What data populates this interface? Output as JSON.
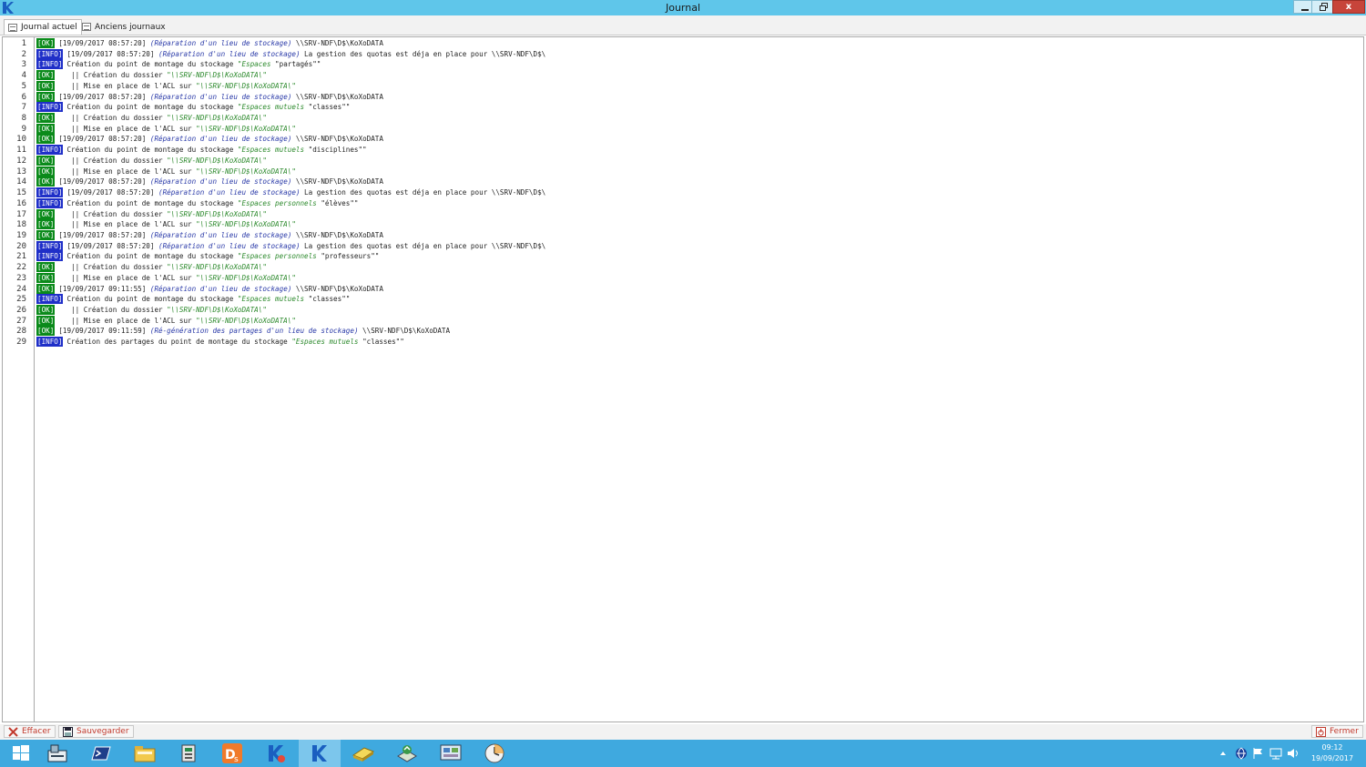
{
  "window": {
    "title": "Journal",
    "close_label": "x"
  },
  "tabs": [
    {
      "label": "Journal actuel",
      "icon": "log-icon",
      "active": true
    },
    {
      "label": "Anciens journaux",
      "icon": "log-icon",
      "active": false
    }
  ],
  "log_lines": [
    {
      "num": "1",
      "level": "[OK]",
      "ts": "[19/09/2017 08:57:20]",
      "ctx": "(Réparation d'un lieu de stockage)",
      "text": " \\\\SRV-NDF\\D$\\KoXoDATA",
      "quote": "",
      "tail": ""
    },
    {
      "num": "2",
      "level": "[INFO]",
      "ts": "[19/09/2017 08:57:20]",
      "ctx": "(Réparation d'un lieu de stockage)",
      "text": " La gestion des quotas est déja en place pour \\\\SRV-NDF\\D$\\",
      "quote": "",
      "tail": ""
    },
    {
      "num": "3",
      "level": "[INFO]",
      "ts": "",
      "ctx": "",
      "text": "Création du point de montage du stockage ",
      "quote": "\"Espaces ",
      "tail": "\"partagés\"\""
    },
    {
      "num": "4",
      "level": "[OK]",
      "ts": "",
      "ctx": "",
      "text": "   || Création du dossier ",
      "quote": "\"\\\\SRV-NDF\\D$\\KoXoDATA\\\"",
      "tail": ""
    },
    {
      "num": "5",
      "level": "[OK]",
      "ts": "",
      "ctx": "",
      "text": "   || Mise en place de l'ACL sur ",
      "quote": "\"\\\\SRV-NDF\\D$\\KoXoDATA\\\"",
      "tail": ""
    },
    {
      "num": "6",
      "level": "[OK]",
      "ts": "[19/09/2017 08:57:20]",
      "ctx": "(Réparation d'un lieu de stockage)",
      "text": " \\\\SRV-NDF\\D$\\KoXoDATA",
      "quote": "",
      "tail": ""
    },
    {
      "num": "7",
      "level": "[INFO]",
      "ts": "",
      "ctx": "",
      "text": "Création du point de montage du stockage ",
      "quote": "\"Espaces mutuels ",
      "tail": "\"classes\"\""
    },
    {
      "num": "8",
      "level": "[OK]",
      "ts": "",
      "ctx": "",
      "text": "   || Création du dossier ",
      "quote": "\"\\\\SRV-NDF\\D$\\KoXoDATA\\\"",
      "tail": ""
    },
    {
      "num": "9",
      "level": "[OK]",
      "ts": "",
      "ctx": "",
      "text": "   || Mise en place de l'ACL sur ",
      "quote": "\"\\\\SRV-NDF\\D$\\KoXoDATA\\\"",
      "tail": ""
    },
    {
      "num": "10",
      "level": "[OK]",
      "ts": "[19/09/2017 08:57:20]",
      "ctx": "(Réparation d'un lieu de stockage)",
      "text": " \\\\SRV-NDF\\D$\\KoXoDATA",
      "quote": "",
      "tail": ""
    },
    {
      "num": "11",
      "level": "[INFO]",
      "ts": "",
      "ctx": "",
      "text": "Création du point de montage du stockage ",
      "quote": "\"Espaces mutuels ",
      "tail": "\"disciplines\"\""
    },
    {
      "num": "12",
      "level": "[OK]",
      "ts": "",
      "ctx": "",
      "text": "   || Création du dossier ",
      "quote": "\"\\\\SRV-NDF\\D$\\KoXoDATA\\\"",
      "tail": ""
    },
    {
      "num": "13",
      "level": "[OK]",
      "ts": "",
      "ctx": "",
      "text": "   || Mise en place de l'ACL sur ",
      "quote": "\"\\\\SRV-NDF\\D$\\KoXoDATA\\\"",
      "tail": ""
    },
    {
      "num": "14",
      "level": "[OK]",
      "ts": "[19/09/2017 08:57:20]",
      "ctx": "(Réparation d'un lieu de stockage)",
      "text": " \\\\SRV-NDF\\D$\\KoXoDATA",
      "quote": "",
      "tail": ""
    },
    {
      "num": "15",
      "level": "[INFO]",
      "ts": "[19/09/2017 08:57:20]",
      "ctx": "(Réparation d'un lieu de stockage)",
      "text": " La gestion des quotas est déja en place pour \\\\SRV-NDF\\D$\\",
      "quote": "",
      "tail": ""
    },
    {
      "num": "16",
      "level": "[INFO]",
      "ts": "",
      "ctx": "",
      "text": "Création du point de montage du stockage ",
      "quote": "\"Espaces personnels ",
      "tail": "\"élèves\"\""
    },
    {
      "num": "17",
      "level": "[OK]",
      "ts": "",
      "ctx": "",
      "text": "   || Création du dossier ",
      "quote": "\"\\\\SRV-NDF\\D$\\KoXoDATA\\\"",
      "tail": ""
    },
    {
      "num": "18",
      "level": "[OK]",
      "ts": "",
      "ctx": "",
      "text": "   || Mise en place de l'ACL sur ",
      "quote": "\"\\\\SRV-NDF\\D$\\KoXoDATA\\\"",
      "tail": ""
    },
    {
      "num": "19",
      "level": "[OK]",
      "ts": "[19/09/2017 08:57:20]",
      "ctx": "(Réparation d'un lieu de stockage)",
      "text": " \\\\SRV-NDF\\D$\\KoXoDATA",
      "quote": "",
      "tail": ""
    },
    {
      "num": "20",
      "level": "[INFO]",
      "ts": "[19/09/2017 08:57:20]",
      "ctx": "(Réparation d'un lieu de stockage)",
      "text": " La gestion des quotas est déja en place pour \\\\SRV-NDF\\D$\\",
      "quote": "",
      "tail": ""
    },
    {
      "num": "21",
      "level": "[INFO]",
      "ts": "",
      "ctx": "",
      "text": "Création du point de montage du stockage ",
      "quote": "\"Espaces personnels ",
      "tail": "\"professeurs\"\""
    },
    {
      "num": "22",
      "level": "[OK]",
      "ts": "",
      "ctx": "",
      "text": "   || Création du dossier ",
      "quote": "\"\\\\SRV-NDF\\D$\\KoXoDATA\\\"",
      "tail": ""
    },
    {
      "num": "23",
      "level": "[OK]",
      "ts": "",
      "ctx": "",
      "text": "   || Mise en place de l'ACL sur ",
      "quote": "\"\\\\SRV-NDF\\D$\\KoXoDATA\\\"",
      "tail": ""
    },
    {
      "num": "24",
      "level": "[OK]",
      "ts": "[19/09/2017 09:11:55]",
      "ctx": "(Réparation d'un lieu de stockage)",
      "text": " \\\\SRV-NDF\\D$\\KoXoDATA",
      "quote": "",
      "tail": ""
    },
    {
      "num": "25",
      "level": "[INFO]",
      "ts": "",
      "ctx": "",
      "text": "Création du point de montage du stockage ",
      "quote": "\"Espaces mutuels ",
      "tail": "\"classes\"\""
    },
    {
      "num": "26",
      "level": "[OK]",
      "ts": "",
      "ctx": "",
      "text": "   || Création du dossier ",
      "quote": "\"\\\\SRV-NDF\\D$\\KoXoDATA\\\"",
      "tail": ""
    },
    {
      "num": "27",
      "level": "[OK]",
      "ts": "",
      "ctx": "",
      "text": "   || Mise en place de l'ACL sur ",
      "quote": "\"\\\\SRV-NDF\\D$\\KoXoDATA\\\"",
      "tail": ""
    },
    {
      "num": "28",
      "level": "[OK]",
      "ts": "[19/09/2017 09:11:59]",
      "ctx": "(Ré-génération des partages d'un lieu de stockage)",
      "text": " \\\\SRV-NDF\\D$\\KoXoDATA",
      "quote": "",
      "tail": ""
    },
    {
      "num": "29",
      "level": "[INFO]",
      "ts": "",
      "ctx": "",
      "text": "Création des partages du point de montage du stockage ",
      "quote": "\"Espaces mutuels ",
      "tail": "\"classes\"\""
    }
  ],
  "bottom": {
    "clear_label": "Effacer",
    "save_label": "Sauvegarder",
    "close_label": "Fermer"
  },
  "taskbar": {
    "items": [
      "start-icon",
      "server-manager-icon",
      "powershell-icon",
      "explorer-icon",
      "archive-icon",
      "ds-app-icon",
      "koxo-tool-icon",
      "koxo-app-icon",
      "notepad-icon",
      "network-tool-icon",
      "control-panel-icon",
      "clock-app-icon"
    ],
    "time": "09:12",
    "date": "19/09/2017"
  },
  "colors": {
    "titlebar": "#5fc6ea",
    "taskbar": "#3fa9df",
    "ok_badge": "#0a8a1a",
    "info_badge": "#1f2fc8",
    "context_text": "#2a3aa8",
    "quote_text": "#2d8a2d",
    "action_red": "#c23b2e"
  }
}
